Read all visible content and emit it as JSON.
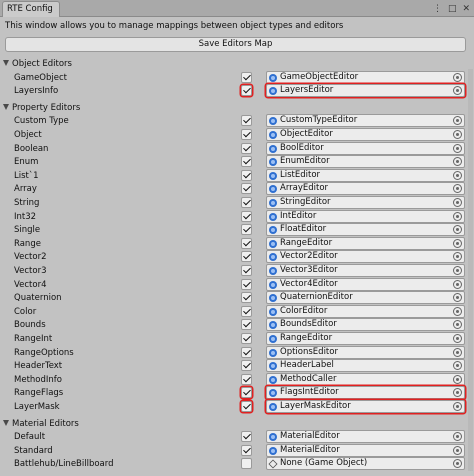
{
  "window": {
    "tab_title": "RTE Config",
    "menu_glyph": "⋮",
    "max_glyph": "□",
    "close_glyph": "✕"
  },
  "description": "This window allows you to manage mappings between object types and editors",
  "save_button_label": "Save Editors Map",
  "sections": [
    {
      "title": "Object Editors",
      "rows": [
        {
          "label": "GameObject",
          "checked": true,
          "editor": "GameObjectEditor",
          "icon": "script-icon",
          "highlight": false
        },
        {
          "label": "LayersInfo",
          "checked": true,
          "editor": "LayersEditor",
          "icon": "script-icon",
          "highlight": true
        }
      ]
    },
    {
      "title": "Property Editors",
      "rows": [
        {
          "label": "Custom Type",
          "checked": true,
          "editor": "CustomTypeEditor",
          "icon": "script-icon",
          "highlight": false
        },
        {
          "label": "Object",
          "checked": true,
          "editor": "ObjectEditor",
          "icon": "script-icon",
          "highlight": false
        },
        {
          "label": "Boolean",
          "checked": true,
          "editor": "BoolEditor",
          "icon": "script-icon",
          "highlight": false
        },
        {
          "label": "Enum",
          "checked": true,
          "editor": "EnumEditor",
          "icon": "script-icon",
          "highlight": false
        },
        {
          "label": "List`1",
          "checked": true,
          "editor": "ListEditor",
          "icon": "script-icon",
          "highlight": false
        },
        {
          "label": "Array",
          "checked": true,
          "editor": "ArrayEditor",
          "icon": "script-icon",
          "highlight": false
        },
        {
          "label": "String",
          "checked": true,
          "editor": "StringEditor",
          "icon": "script-icon",
          "highlight": false
        },
        {
          "label": "Int32",
          "checked": true,
          "editor": "IntEditor",
          "icon": "script-icon",
          "highlight": false
        },
        {
          "label": "Single",
          "checked": true,
          "editor": "FloatEditor",
          "icon": "script-icon",
          "highlight": false
        },
        {
          "label": "Range",
          "checked": true,
          "editor": "RangeEditor",
          "icon": "script-icon",
          "highlight": false
        },
        {
          "label": "Vector2",
          "checked": true,
          "editor": "Vector2Editor",
          "icon": "script-icon",
          "highlight": false
        },
        {
          "label": "Vector3",
          "checked": true,
          "editor": "Vector3Editor",
          "icon": "script-icon",
          "highlight": false
        },
        {
          "label": "Vector4",
          "checked": true,
          "editor": "Vector4Editor",
          "icon": "script-icon",
          "highlight": false
        },
        {
          "label": "Quaternion",
          "checked": true,
          "editor": "QuaternionEditor",
          "icon": "script-icon",
          "highlight": false
        },
        {
          "label": "Color",
          "checked": true,
          "editor": "ColorEditor",
          "icon": "script-icon",
          "highlight": false
        },
        {
          "label": "Bounds",
          "checked": true,
          "editor": "BoundsEditor",
          "icon": "script-icon",
          "highlight": false
        },
        {
          "label": "RangeInt",
          "checked": true,
          "editor": "RangeEditor",
          "icon": "script-icon",
          "highlight": false
        },
        {
          "label": "RangeOptions",
          "checked": true,
          "editor": "OptionsEditor",
          "icon": "script-icon",
          "highlight": false
        },
        {
          "label": "HeaderText",
          "checked": true,
          "editor": "HeaderLabel",
          "icon": "script-icon",
          "highlight": false
        },
        {
          "label": "MethodInfo",
          "checked": true,
          "editor": "MethodCaller",
          "icon": "script-icon",
          "highlight": false
        },
        {
          "label": "RangeFlags",
          "checked": true,
          "editor": "FlagsIntEditor",
          "icon": "script-icon",
          "highlight": true
        },
        {
          "label": "LayerMask",
          "checked": true,
          "editor": "LayerMaskEditor",
          "icon": "script-icon",
          "highlight": true
        }
      ]
    },
    {
      "title": "Material Editors",
      "rows": [
        {
          "label": "Default",
          "checked": true,
          "editor": "MaterialEditor",
          "icon": "script-icon",
          "highlight": false
        },
        {
          "label": "Standard",
          "checked": true,
          "editor": "MaterialEditor",
          "icon": "script-icon",
          "highlight": false
        },
        {
          "label": "Battlehub/LineBillboard",
          "checked": false,
          "editor": "None (Game Object)",
          "icon": "gameobject-icon",
          "highlight": false
        }
      ]
    }
  ],
  "colors": {
    "highlight": "#e02020",
    "script_icon": "#2f6fd0",
    "background": "#c2c2c2"
  }
}
